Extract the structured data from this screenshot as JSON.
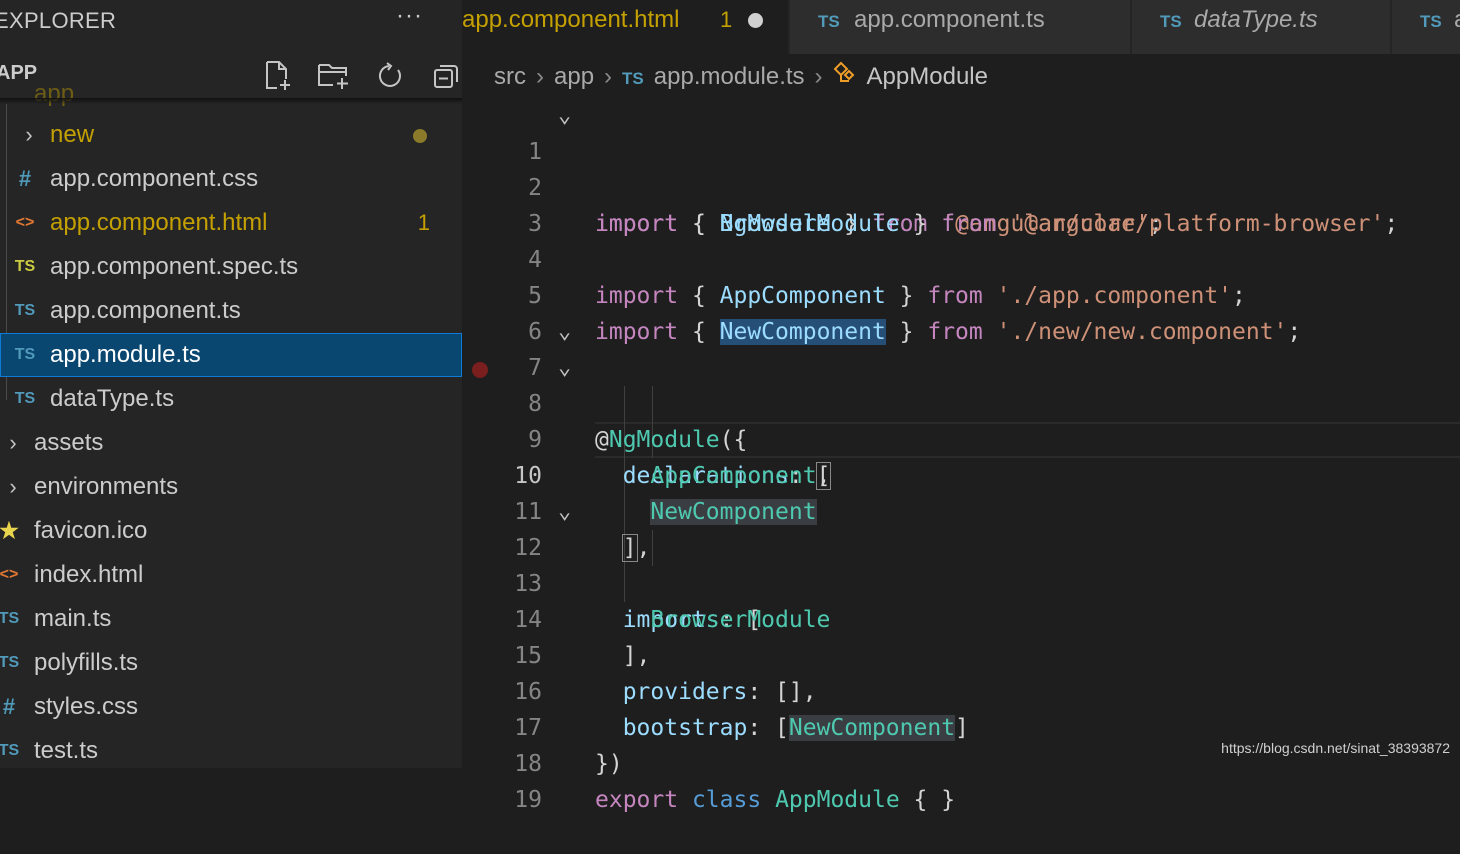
{
  "sidebar": {
    "title": "EXPLORER",
    "more": "···",
    "section": "APP",
    "partial_item": "app",
    "items": [
      {
        "icon": "chevron",
        "label": "new",
        "indent": 1,
        "type": "folder-modified"
      },
      {
        "icon": "#",
        "label": "app.component.css",
        "indent": 1,
        "type": "css"
      },
      {
        "icon": "<>",
        "label": "app.component.html",
        "indent": 1,
        "type": "html",
        "badge": "1"
      },
      {
        "icon": "TS",
        "label": "app.component.spec.ts",
        "indent": 1,
        "type": "spec"
      },
      {
        "icon": "TS",
        "label": "app.component.ts",
        "indent": 1,
        "type": "ts"
      },
      {
        "icon": "TS",
        "label": "app.module.ts",
        "indent": 1,
        "type": "ts",
        "selected": true
      },
      {
        "icon": "TS",
        "label": "dataType.ts",
        "indent": 1,
        "type": "ts"
      },
      {
        "icon": "chevron",
        "label": "assets",
        "indent": 0,
        "type": "folder"
      },
      {
        "icon": "chevron",
        "label": "environments",
        "indent": 0,
        "type": "folder"
      },
      {
        "icon": "star",
        "label": "favicon.ico",
        "indent": 0,
        "type": "ico"
      },
      {
        "icon": "<>",
        "label": "index.html",
        "indent": 0,
        "type": "html"
      },
      {
        "icon": "TS",
        "label": "main.ts",
        "indent": 0,
        "type": "ts"
      },
      {
        "icon": "TS",
        "label": "polyfills.ts",
        "indent": 0,
        "type": "ts"
      },
      {
        "icon": "#",
        "label": "styles.css",
        "indent": 0,
        "type": "css"
      },
      {
        "icon": "TS",
        "label": "test.ts",
        "indent": 0,
        "type": "ts"
      }
    ]
  },
  "tabs": [
    {
      "label": "app.component.html",
      "badge": "1",
      "modified": true,
      "active": true
    },
    {
      "label": "app.component.ts",
      "icon": "TS"
    },
    {
      "label": "dataType.ts",
      "icon": "TS",
      "italic": true
    },
    {
      "label": "a",
      "icon": "TS"
    }
  ],
  "breadcrumb": {
    "parts": [
      "src",
      "app",
      "app.module.ts",
      "AppModule"
    ]
  },
  "code": {
    "current_line": 10,
    "lines": [
      "1",
      "2",
      "3",
      "4",
      "5",
      "6",
      "7",
      "8",
      "9",
      "10",
      "11",
      "12",
      "13",
      "14",
      "15",
      "16",
      "17",
      "18",
      "19"
    ],
    "tokens": {
      "l1": [
        "import",
        " { ",
        "NgModule",
        " } ",
        "from",
        " ",
        "'@angular/core'",
        ";"
      ],
      "l2": [
        "import",
        " { ",
        "BrowserModule",
        " } ",
        "from",
        " ",
        "'@angular/platform-browser'",
        ";"
      ],
      "l4": [
        "import",
        " { ",
        "AppComponent",
        " } ",
        "from",
        " ",
        "'./app.component'",
        ";"
      ],
      "l5": [
        "import",
        " { ",
        "NewComponent",
        " } ",
        "from",
        " ",
        "'./new/new.component'",
        ";"
      ],
      "l7": [
        "@",
        "NgModule",
        "({"
      ],
      "l8": [
        "declarations",
        ": ",
        "["
      ],
      "l9": [
        "AppComponent",
        ","
      ],
      "l10": [
        "NewComponent"
      ],
      "l11": [
        "]",
        ","
      ],
      "l12": [
        "imports",
        ": ["
      ],
      "l13": [
        "BrowserModule"
      ],
      "l14": [
        "],"
      ],
      "l15": [
        "providers",
        ": [],"
      ],
      "l16": [
        "bootstrap",
        ": [",
        "NewComponent",
        "]"
      ],
      "l17": [
        "})"
      ],
      "l18": [
        "export",
        " ",
        "class",
        " ",
        "AppModule",
        " { }"
      ]
    }
  },
  "watermark": "https://blog.csdn.net/sinat_38393872",
  "colors": {
    "accent": "#094771",
    "modified": "#c4a000",
    "ts_icon": "#519aba"
  }
}
